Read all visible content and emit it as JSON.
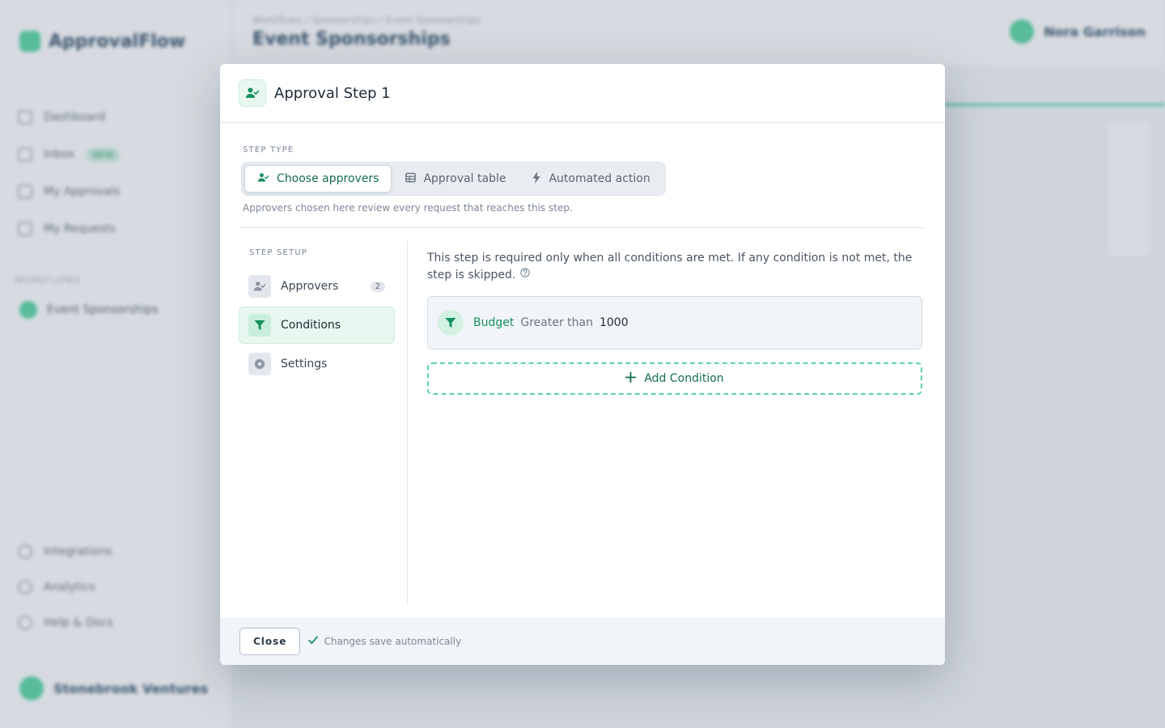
{
  "background": {
    "logo_text": "ApprovalFlow",
    "nav": [
      {
        "label": "Dashboard"
      },
      {
        "label": "Inbox",
        "badge": "NEW"
      },
      {
        "label": "My Approvals"
      },
      {
        "label": "My Requests"
      }
    ],
    "section_label": "WORKFLOWS",
    "workflow": "Event Sponsorships",
    "bottom_nav": [
      {
        "label": "Integrations"
      },
      {
        "label": "Analytics"
      },
      {
        "label": "Help & Docs"
      }
    ],
    "org": "Stonebrook Ventures",
    "breadcrumbs": "Workflows  /  Sponsorships  /  Event Sponsorships",
    "page_title": "Event Sponsorships",
    "user_name": "Nora Garrison"
  },
  "modal": {
    "title": "Approval Step 1",
    "step_type_label": "STEP TYPE",
    "step_types": [
      {
        "label": "Choose approvers",
        "icon": "user-check-icon",
        "active": true
      },
      {
        "label": "Approval table",
        "icon": "table-icon",
        "active": false
      },
      {
        "label": "Automated action",
        "icon": "bolt-icon",
        "active": false
      }
    ],
    "step_type_help": "Approvers chosen here review every request that reaches this step.",
    "setup_label": "STEP SETUP",
    "setup_nav": [
      {
        "label": "Approvers",
        "count": "2",
        "icon": "user-check-icon"
      },
      {
        "label": "Conditions",
        "icon": "filter-icon",
        "active": true
      },
      {
        "label": "Settings",
        "icon": "gear-icon"
      }
    ],
    "conditions_description": "This step is required only when all conditions are met. If any condition is not met, the step is skipped.",
    "condition": {
      "field": "Budget",
      "operator": "Greater than",
      "value": "1000"
    },
    "add_condition_label": "Add Condition",
    "close_label": "Close",
    "save_note": "Changes save automatically"
  },
  "colors": {
    "accent": "#15915c",
    "accent_light": "#e8f7ef",
    "dashed_border": "#5fd6a3"
  }
}
